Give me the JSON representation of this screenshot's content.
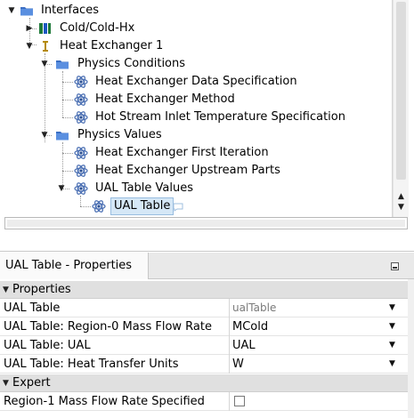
{
  "tree": {
    "nodes": [
      {
        "label": "Interfaces",
        "icon": "folder-icon",
        "expander": "expanded"
      },
      {
        "label": "Cold/Cold-Hx",
        "icon": "interface-icon",
        "expander": "collapsed"
      },
      {
        "label": "Heat Exchanger 1",
        "icon": "heat-exchanger-icon",
        "expander": "expanded"
      },
      {
        "label": "Physics Conditions",
        "icon": "folder-icon",
        "expander": "expanded"
      },
      {
        "label": "Heat Exchanger Data Specification",
        "icon": "physics-atom-icon",
        "expander": "none"
      },
      {
        "label": "Heat Exchanger Method",
        "icon": "physics-atom-icon",
        "expander": "none"
      },
      {
        "label": "Hot Stream Inlet Temperature Specification",
        "icon": "physics-atom-icon",
        "expander": "none"
      },
      {
        "label": "Physics Values",
        "icon": "folder-icon",
        "expander": "expanded"
      },
      {
        "label": "Heat Exchanger First Iteration",
        "icon": "physics-atom-icon",
        "expander": "none"
      },
      {
        "label": "Heat Exchanger Upstream Parts",
        "icon": "physics-atom-icon",
        "expander": "none"
      },
      {
        "label": "UAL Table Values",
        "icon": "physics-atom-icon",
        "expander": "expanded"
      },
      {
        "label": "UAL Table",
        "icon": "physics-atom-icon",
        "expander": "none",
        "selected": true
      }
    ]
  },
  "properties": {
    "tab_title": "UAL Table - Properties",
    "sections": [
      {
        "title": "Properties",
        "rows": [
          {
            "name": "UAL Table",
            "value": "ualTable",
            "muted": true
          },
          {
            "name": "UAL Table: Region-0 Mass Flow Rate",
            "value": "MCold"
          },
          {
            "name": "UAL Table: UAL",
            "value": "UAL"
          },
          {
            "name": "UAL Table: Heat Transfer Units",
            "value": "W"
          }
        ]
      },
      {
        "title": "Expert",
        "rows": [
          {
            "name": "Region-1 Mass Flow Rate Specified",
            "checked": false
          }
        ]
      }
    ]
  },
  "colors": {
    "folder": "#3b6fc4",
    "selection_bg": "#d5e7f6",
    "section_bg": "#e0e0e0"
  }
}
